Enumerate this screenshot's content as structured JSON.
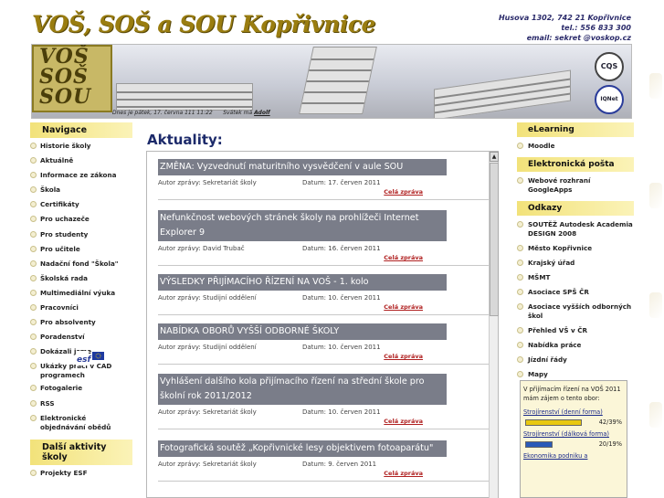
{
  "header": {
    "title": "VOŠ, SOŠ a SOU Kopřivnice",
    "contact_lines": [
      "Husova 1302, 742 21 Kopřivnice",
      "tel.: 556 833 300",
      "email: sekret @voskop.cz"
    ],
    "logo_lines": [
      "VOŠ",
      "SOŠ",
      "SOU"
    ],
    "date_text": "Dnes je pátek, 17. června 111 11:22",
    "nameday_label": "Svátek má",
    "nameday_name": "Adolf",
    "cert1_label": "CQS",
    "cert2_label": "IQNet"
  },
  "left_nav": {
    "heading": "Navigace",
    "items": [
      "Historie školy",
      "Aktuálně",
      "Informace ze zákona",
      "Škola",
      "Certifikáty",
      "Pro uchazeče",
      "Pro studenty",
      "Pro učitele",
      "Nadační fond \"Škola\"",
      "Školská rada",
      "Multimediální výuka",
      "Pracovníci",
      "Pro absolventy",
      "Poradenství",
      "Dokázali jsme",
      "Ukázky prací v CAD programech",
      "Fotogalerie",
      "RSS",
      "Elektronické objednávání obědů"
    ],
    "heading2": "Další aktivity školy",
    "items2": [
      "Projekty ESF"
    ],
    "esf_label": "esf"
  },
  "main": {
    "title": "Aktuality:",
    "author_prefix": "Autor zprávy: ",
    "date_prefix": "Datum: ",
    "more_label": "Celá zpráva",
    "news": [
      {
        "title": "ZMĚNA: Vyzvednutí maturitního vysvědčení v aule SOU",
        "author": "Sekretariát školy",
        "date": "17. červen 2011"
      },
      {
        "title": "Nefunkčnost webových stránek školy na prohlížeči Internet Explorer 9",
        "author": "David Trubač",
        "date": "16. červen 2011"
      },
      {
        "title": "VÝSLEDKY PŘIJÍMACÍHO ŘÍZENÍ NA VOŠ - 1. kolo",
        "author": "Studijní oddělení",
        "date": "10. červen 2011"
      },
      {
        "title": "NABÍDKA OBORŮ VYŠŠÍ ODBORNÉ ŠKOLY",
        "author": "Studijní oddělení",
        "date": "10. červen 2011"
      },
      {
        "title": "Vyhlášení dalšího kola přijímacího řízení na střední škole pro školní rok 2011/2012",
        "author": "Sekretariát školy",
        "date": "10. červen 2011"
      },
      {
        "title": "Fotografická soutěž „Kopřivnické lesy objektivem fotoaparátu\"",
        "author": "Sekretariát školy",
        "date": "9. červen 2011"
      }
    ]
  },
  "right_nav": {
    "elearning_heading": "eLearning",
    "elearning_items": [
      "Moodle"
    ],
    "mail_heading": "Elektronická pošta",
    "mail_items": [
      "Webové rozhraní GoogleApps"
    ],
    "links_heading": "Odkazy",
    "links_items": [
      "SOUTĚŽ Autodesk Academia DESIGN 2008",
      "Město Kopřivnice",
      "Krajský úřad",
      "MŠMT",
      "Asociace SPŠ ČR",
      "Asociace vyšších odborných škol",
      "Přehled VŠ v ČR",
      "Nabídka práce",
      "Jízdní řády",
      "Mapy"
    ]
  },
  "poll": {
    "question": "V přijímacím řízení na VOŠ 2011 mám zájem o tento obor:",
    "options": [
      {
        "label": "Strojírenství (denní forma)",
        "pct": "42/39%",
        "fraction": 0.39,
        "color": "#e8c810"
      },
      {
        "label": "Strojírenství (dálková forma)",
        "pct": "20/19%",
        "fraction": 0.19,
        "color": "#2a5ab8"
      },
      {
        "label": "Ekonomika podniku a",
        "pct": "",
        "fraction": 0,
        "color": "#cccccc"
      }
    ]
  }
}
